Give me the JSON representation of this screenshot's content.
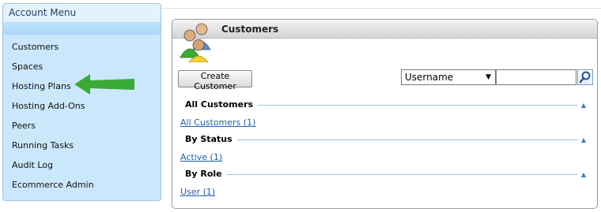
{
  "account_menu": {
    "title": "Account Menu",
    "items": [
      {
        "label": "Customers"
      },
      {
        "label": "Spaces"
      },
      {
        "label": "Hosting Plans"
      },
      {
        "label": "Hosting Add-Ons"
      },
      {
        "label": "Peers"
      },
      {
        "label": "Running Tasks"
      },
      {
        "label": "Audit Log"
      },
      {
        "label": "Ecommerce Admin"
      }
    ]
  },
  "customers_panel": {
    "title": "Customers",
    "create_button": "Create Customer",
    "search": {
      "field_selected": "Username",
      "value": ""
    },
    "sections": [
      {
        "heading": "All Customers",
        "link": "All Customers (1)"
      },
      {
        "heading": "By Status",
        "link": "Active (1)"
      },
      {
        "heading": "By Role",
        "link": "User (1)"
      }
    ]
  },
  "colors": {
    "menu_background": "#cbe7fb",
    "arrow": "#3aaa35",
    "link": "#1f5fb0"
  },
  "icons": {
    "customers": "users-group-icon",
    "search": "magnifier-icon",
    "collapse": "caret-up-icon",
    "annotation": "green-arrow-icon"
  }
}
